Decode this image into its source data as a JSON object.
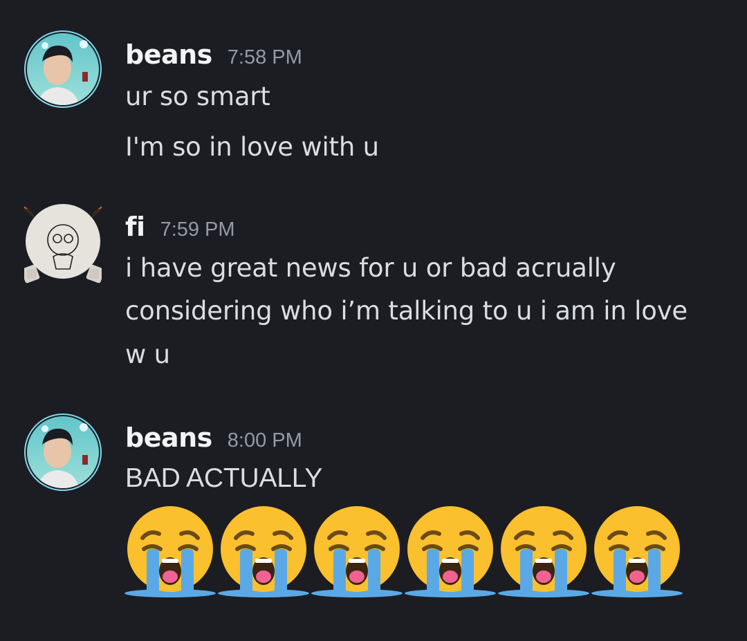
{
  "messages": [
    {
      "username": "beans",
      "timestamp": "7:58 PM",
      "lines": [
        "ur so smart",
        "I'm so in love with u"
      ]
    },
    {
      "username": "fi",
      "timestamp": "7:59 PM",
      "lines": [
        "i have great news for u or bad acrually",
        "considering who i’m talking to u i am in love",
        "w u"
      ]
    },
    {
      "username": "beans",
      "timestamp": "8:00 PM",
      "lines": [
        "BAD ACTUALLY"
      ],
      "emoji_count": 6,
      "emoji_name": "loudly-crying-face"
    }
  ],
  "colors": {
    "background": "#1c1d22",
    "username": "#f2f3f5",
    "timestamp": "#949ba4",
    "message_text": "#dbdee1",
    "emoji_face": "#fbc02d",
    "emoji_tears": "#5aa9e6"
  }
}
